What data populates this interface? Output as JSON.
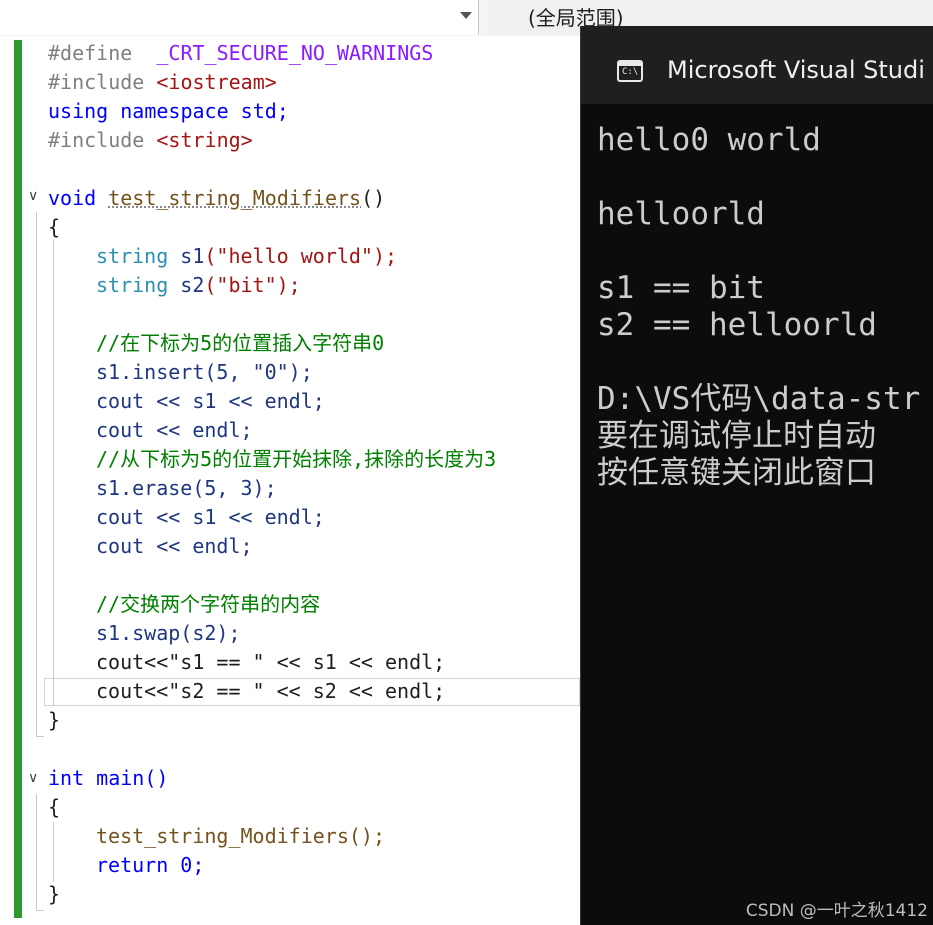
{
  "top_bar": {
    "scope_label": "(全局范围)"
  },
  "editor": {
    "code_lines": [
      [
        "#define",
        "_CRT_SECURE_NO_WARNINGS"
      ],
      [
        "#include",
        "<iostream>"
      ],
      [
        "using namespace std;"
      ],
      [
        "#include",
        "<string>"
      ],
      [
        ""
      ],
      [
        "void",
        "test_string_Modifiers",
        "()"
      ],
      [
        "{"
      ],
      [
        "string",
        "s1",
        "(\"hello world\");"
      ],
      [
        "string",
        "s2",
        "(\"bit\");"
      ],
      [
        ""
      ],
      [
        "//在下标为5的位置插入字符串0"
      ],
      [
        "s1.insert(5, \"0\");"
      ],
      [
        "cout << s1 << endl;"
      ],
      [
        "cout << endl;"
      ],
      [
        "//从下标为5的位置开始抹除,抹除的长度为3"
      ],
      [
        "s1.erase(5, 3);"
      ],
      [
        "cout << s1 << endl;"
      ],
      [
        "cout << endl;"
      ],
      [
        ""
      ],
      [
        "//交换两个字符串的内容"
      ],
      [
        "s1.swap(s2);"
      ],
      [
        "cout<<\"s1 == \" << s1 << endl;"
      ],
      [
        "cout<<\"s2 == \" << s2 << endl;"
      ],
      [
        "}"
      ],
      [
        ""
      ],
      [
        "int main()"
      ],
      [
        "{"
      ],
      [
        "test_string_Modifiers();"
      ],
      [
        "return 0;"
      ],
      [
        "}"
      ]
    ]
  },
  "console": {
    "title": "Microsoft Visual Studi",
    "icon": "cmd-icon",
    "output": [
      "hello0 world",
      "",
      "helloorld",
      "",
      "s1 == bit",
      "s2 == helloorld",
      "",
      "D:\\VS代码\\data-str",
      "要在调试停止时自动",
      "按任意键关闭此窗口"
    ]
  },
  "watermark": "CSDN @一叶之秋1412"
}
